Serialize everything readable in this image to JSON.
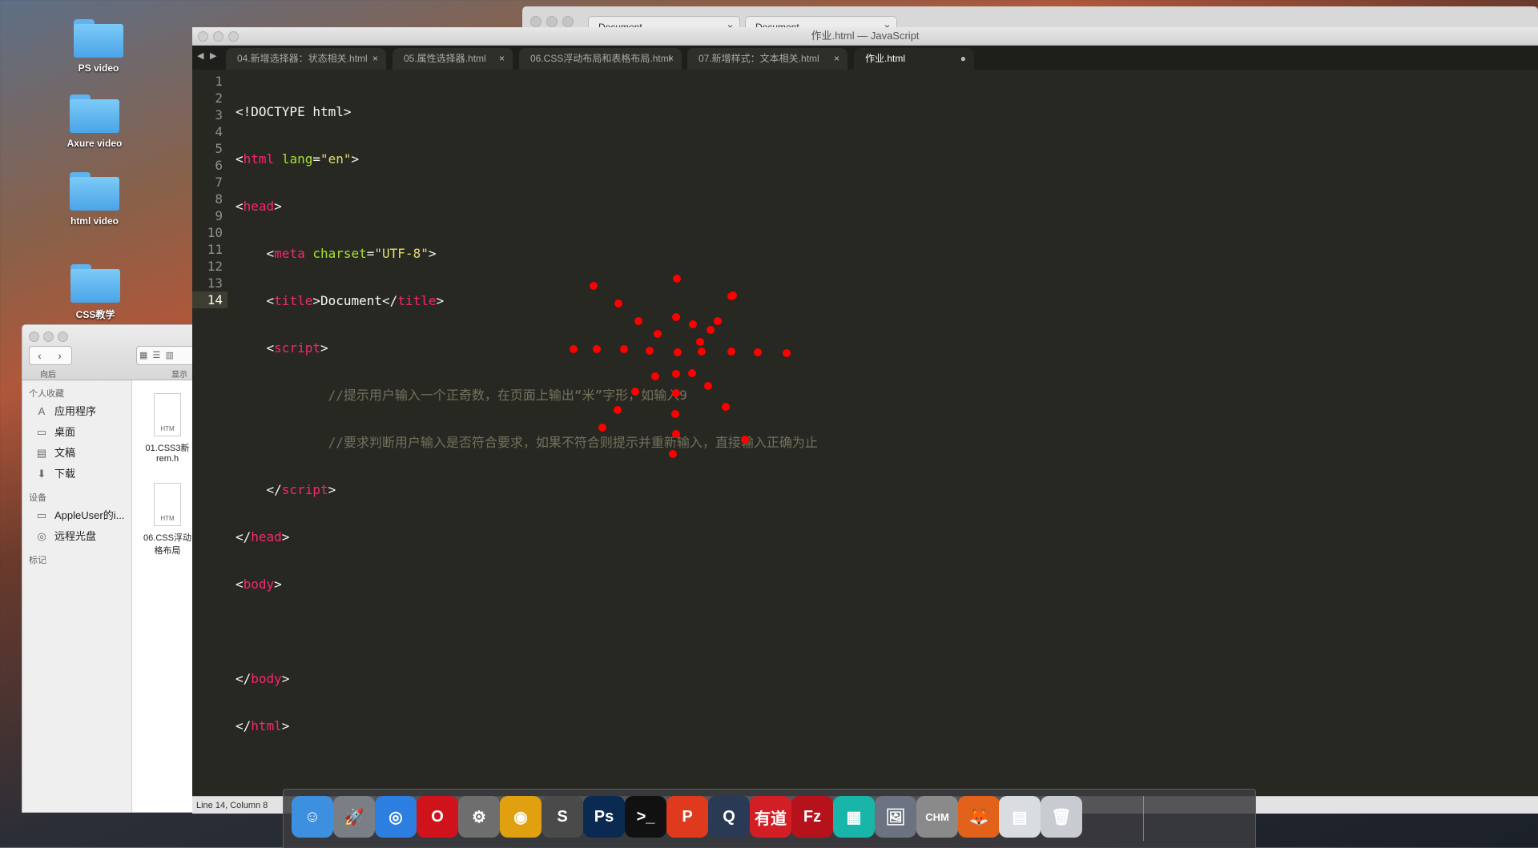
{
  "desktop": {
    "icons": [
      {
        "label": "PS video"
      },
      {
        "label": "Axure video"
      },
      {
        "label": "html video"
      },
      {
        "label": "CSS教学"
      }
    ]
  },
  "browser": {
    "tabs": [
      {
        "label": "Document"
      },
      {
        "label": "Document"
      }
    ]
  },
  "finder": {
    "nav_label": "向后",
    "view_label": "显示",
    "sections": {
      "favorites": "个人收藏",
      "devices": "设备",
      "tags": "标记"
    },
    "favorites": [
      {
        "label": "应用程序",
        "icon": "apps-icon"
      },
      {
        "label": "桌面",
        "icon": "desktop-icon"
      },
      {
        "label": "文稿",
        "icon": "documents-icon"
      },
      {
        "label": "下载",
        "icon": "download-icon"
      }
    ],
    "devices": [
      {
        "label": "AppleUser的i...",
        "icon": "computer-icon"
      },
      {
        "label": "远程光盘",
        "icon": "disc-icon"
      }
    ],
    "files": [
      {
        "name_line1": "01.CSS3新",
        "name_line2": "rem.h",
        "badge": "HTM"
      },
      {
        "name_line1": "06.CSS浮动",
        "name_line2": "格布局",
        "badge": "HTM"
      }
    ]
  },
  "editor": {
    "window_title": "作业.html — JavaScript",
    "tabs": [
      {
        "label": "04.新增选择器：状态相关.html",
        "close": "×"
      },
      {
        "label": "05.属性选择器.html",
        "close": "×"
      },
      {
        "label": "06.CSS浮动布局和表格布局.html",
        "close": "×"
      },
      {
        "label": "07.新增样式：文本相关.html",
        "close": "×"
      },
      {
        "label": "作业.html",
        "close": "●"
      }
    ],
    "line_numbers": [
      "1",
      "2",
      "3",
      "4",
      "5",
      "6",
      "7",
      "8",
      "9",
      "10",
      "11",
      "12",
      "13",
      "14"
    ],
    "code": {
      "l1": "<!DOCTYPE html>",
      "l2_open": "<",
      "l2_tag": "html",
      "l2_attr": " lang",
      "l2_eq": "=",
      "l2_val": "\"en\"",
      "l2_close": ">",
      "l3_open": "<",
      "l3_tag": "head",
      "l3_close": ">",
      "l4_indent": "    ",
      "l4_open": "<",
      "l4_tag": "meta",
      "l4_attr": " charset",
      "l4_eq": "=",
      "l4_val": "\"UTF-8\"",
      "l4_close": ">",
      "l5_indent": "    ",
      "l5_open": "<",
      "l5_tag": "title",
      "l5_mid": ">Document</",
      "l5_tag2": "title",
      "l5_close": ">",
      "l6_indent": "    ",
      "l6_open": "<",
      "l6_tag": "script",
      "l6_close": ">",
      "l7_indent": "            ",
      "l7_comment": "//提示用户输入一个正奇数，在页面上输出“米”字形，如输入9",
      "l8_indent": "            ",
      "l8_comment": "//要求判断用户输入是否符合要求，如果不符合则提示并重新输入，直接输入正确为止",
      "l9_indent": "    ",
      "l9_open": "</",
      "l9_tag": "script",
      "l9_close": ">",
      "l10_open": "</",
      "l10_tag": "head",
      "l10_close": ">",
      "l11_open": "<",
      "l11_tag": "body",
      "l11_close": ">",
      "l12": "",
      "l13_open": "</",
      "l13_tag": "body",
      "l13_close": ">",
      "l14_open": "</",
      "l14_tag": "html",
      "l14_close": ">"
    },
    "status": "Line 14, Column 8",
    "drawing_color": "#ff0000"
  },
  "dock": {
    "apps": [
      {
        "name": "finder",
        "glyph": "☺",
        "bg": "#3d8fe0"
      },
      {
        "name": "launchpad",
        "glyph": "🚀",
        "bg": "#7a7f86"
      },
      {
        "name": "safari",
        "glyph": "◎",
        "bg": "#2c7fe0"
      },
      {
        "name": "opera",
        "glyph": "O",
        "bg": "#d0121b"
      },
      {
        "name": "system-preferences",
        "glyph": "⚙",
        "bg": "#6e6e6e"
      },
      {
        "name": "chrome",
        "glyph": "◉",
        "bg": "#e0a010"
      },
      {
        "name": "sublime-text",
        "glyph": "S",
        "bg": "#4a4a4a"
      },
      {
        "name": "photoshop",
        "glyph": "Ps",
        "bg": "#0a2a52"
      },
      {
        "name": "terminal",
        "glyph": ">_",
        "bg": "#111111"
      },
      {
        "name": "wps",
        "glyph": "P",
        "bg": "#e03a1e"
      },
      {
        "name": "quicktime",
        "glyph": "Q",
        "bg": "#2a3a55"
      },
      {
        "name": "youdao",
        "glyph": "有道",
        "bg": "#d21f26"
      },
      {
        "name": "filezilla",
        "glyph": "Fz",
        "bg": "#b5121b"
      },
      {
        "name": "mosaic",
        "glyph": "▦",
        "bg": "#19b5a8"
      },
      {
        "name": "preview",
        "glyph": "🖼",
        "bg": "#6b7380"
      },
      {
        "name": "chm-viewer",
        "glyph": "CHM",
        "bg": "#8a8a8a"
      },
      {
        "name": "firefox",
        "glyph": "🦊",
        "bg": "#e2621b"
      },
      {
        "name": "documents",
        "glyph": "▤",
        "bg": "#d9dde2"
      },
      {
        "name": "trash",
        "glyph": "🗑",
        "bg": "#c8ccd1"
      }
    ]
  }
}
